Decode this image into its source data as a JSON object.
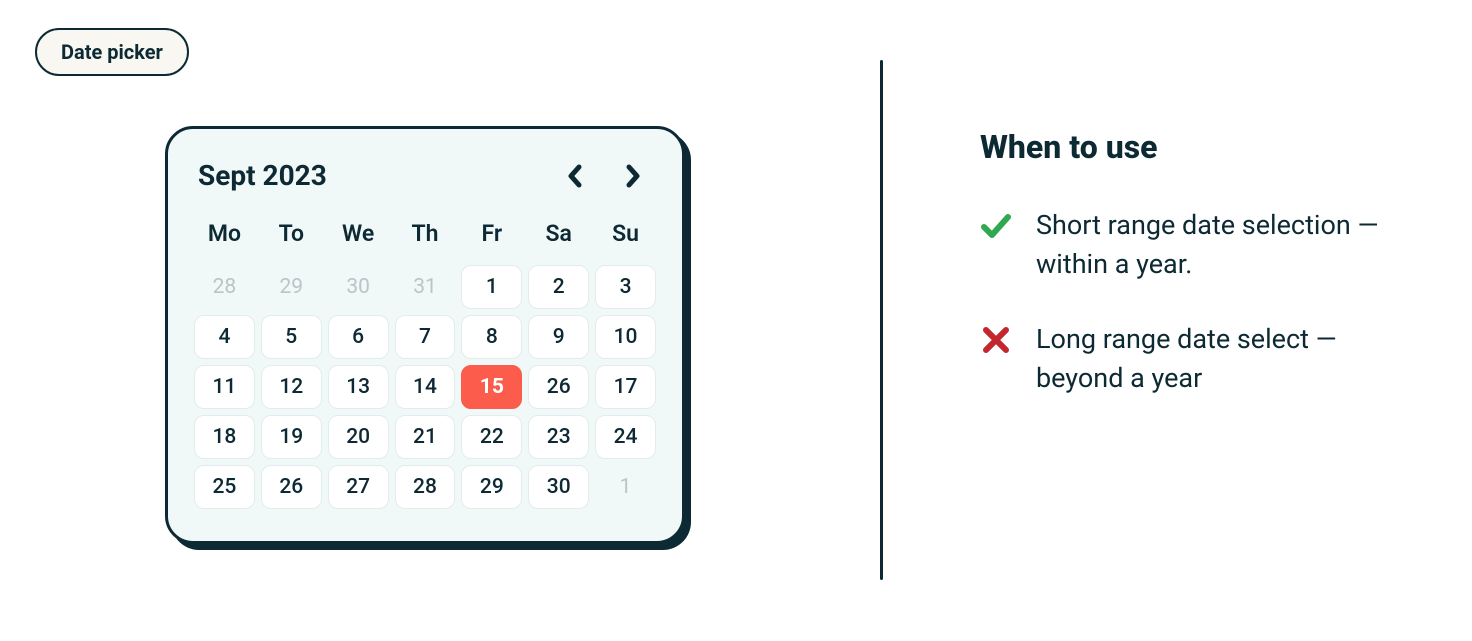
{
  "pill_label": "Date picker",
  "calendar": {
    "title": "Sept 2023",
    "days_of_week": [
      "Mo",
      "To",
      "We",
      "Th",
      "Fr",
      "Sa",
      "Su"
    ],
    "weeks": [
      [
        {
          "n": "28",
          "muted": true
        },
        {
          "n": "29",
          "muted": true
        },
        {
          "n": "30",
          "muted": true
        },
        {
          "n": "31",
          "muted": true
        },
        {
          "n": "1"
        },
        {
          "n": "2"
        },
        {
          "n": "3"
        }
      ],
      [
        {
          "n": "4"
        },
        {
          "n": "5"
        },
        {
          "n": "6"
        },
        {
          "n": "7"
        },
        {
          "n": "8"
        },
        {
          "n": "9"
        },
        {
          "n": "10"
        }
      ],
      [
        {
          "n": "11"
        },
        {
          "n": "12"
        },
        {
          "n": "13"
        },
        {
          "n": "14"
        },
        {
          "n": "15",
          "selected": true
        },
        {
          "n": "26"
        },
        {
          "n": "17"
        }
      ],
      [
        {
          "n": "18"
        },
        {
          "n": "19"
        },
        {
          "n": "20"
        },
        {
          "n": "21"
        },
        {
          "n": "22"
        },
        {
          "n": "23"
        },
        {
          "n": "24"
        }
      ],
      [
        {
          "n": "25"
        },
        {
          "n": "26"
        },
        {
          "n": "27"
        },
        {
          "n": "28"
        },
        {
          "n": "29"
        },
        {
          "n": "30"
        },
        {
          "n": "1",
          "muted": true
        }
      ]
    ]
  },
  "info": {
    "heading": "When to use",
    "items": [
      {
        "kind": "check",
        "text": "Short range date selection — within a year."
      },
      {
        "kind": "cross",
        "text": "Long range date select — beyond a year"
      }
    ]
  },
  "colors": {
    "check": "#2fa84f",
    "cross": "#c4262e",
    "selected": "#fb5c4c",
    "ink": "#0d2a34"
  }
}
